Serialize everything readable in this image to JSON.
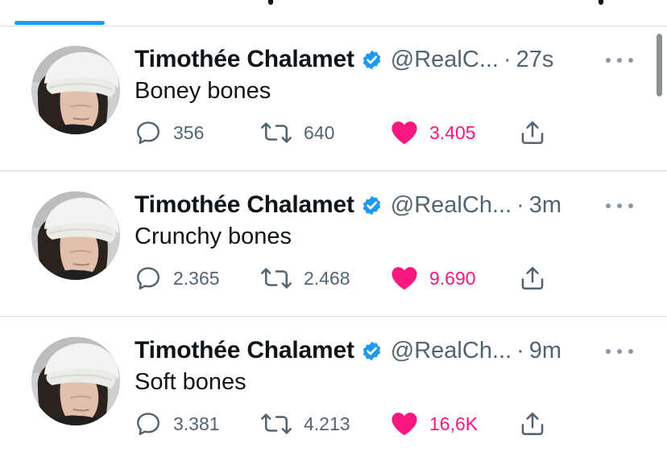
{
  "colors": {
    "accent": "#1d9bf0",
    "like": "#f91880",
    "secondary_text": "#536471",
    "divider": "#d9dde1"
  },
  "tweets": [
    {
      "name": "Timothée Chalamet",
      "handle": "@RealC...",
      "separator": "·",
      "time": "27s",
      "text": "Boney bones",
      "replies": "356",
      "retweets": "640",
      "likes": "3.405",
      "liked": true
    },
    {
      "name": "Timothée Chalamet",
      "handle": "@RealCh...",
      "separator": "·",
      "time": "3m",
      "text": "Crunchy bones",
      "replies": "2.365",
      "retweets": "2.468",
      "likes": "9.690",
      "liked": true
    },
    {
      "name": "Timothée Chalamet",
      "handle": "@RealCh...",
      "separator": "·",
      "time": "9m",
      "text": "Soft bones",
      "replies": "3.381",
      "retweets": "4.213",
      "likes": "16,6K",
      "liked": true
    }
  ],
  "icons": {
    "verified": "verified-badge-icon",
    "more": "more-icon",
    "reply": "reply-icon",
    "retweet": "retweet-icon",
    "like": "heart-icon",
    "share": "share-icon"
  }
}
